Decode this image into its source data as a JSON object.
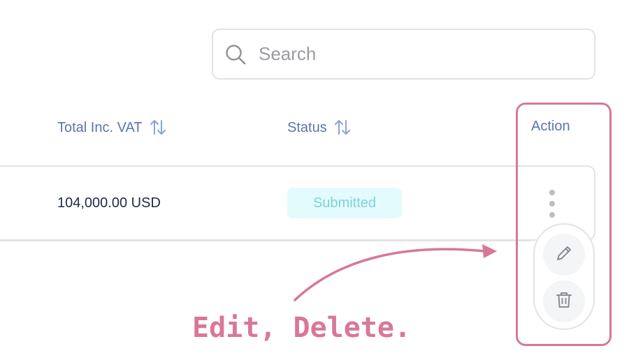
{
  "search": {
    "placeholder": "Search",
    "value": "",
    "icon": "search-icon"
  },
  "table": {
    "columns": [
      {
        "label": "Total Inc. VAT",
        "sortable": true
      },
      {
        "label": "Status",
        "sortable": true
      },
      {
        "label": "Action",
        "sortable": false
      }
    ],
    "rows": [
      {
        "total": "104,000.00 USD",
        "status": "Submitted"
      }
    ]
  },
  "action_menu": {
    "items": [
      {
        "name": "edit",
        "icon": "pencil-icon"
      },
      {
        "name": "delete",
        "icon": "trash-icon"
      }
    ]
  },
  "annotation": {
    "text": "Edit, Delete."
  },
  "colors": {
    "header_text": "#5a76ad",
    "cell_text": "#1f2a44",
    "badge_bg": "#e4fbfd",
    "badge_text": "#7dd3d6",
    "border": "#e3e3e5",
    "annotation": "#d97799"
  }
}
